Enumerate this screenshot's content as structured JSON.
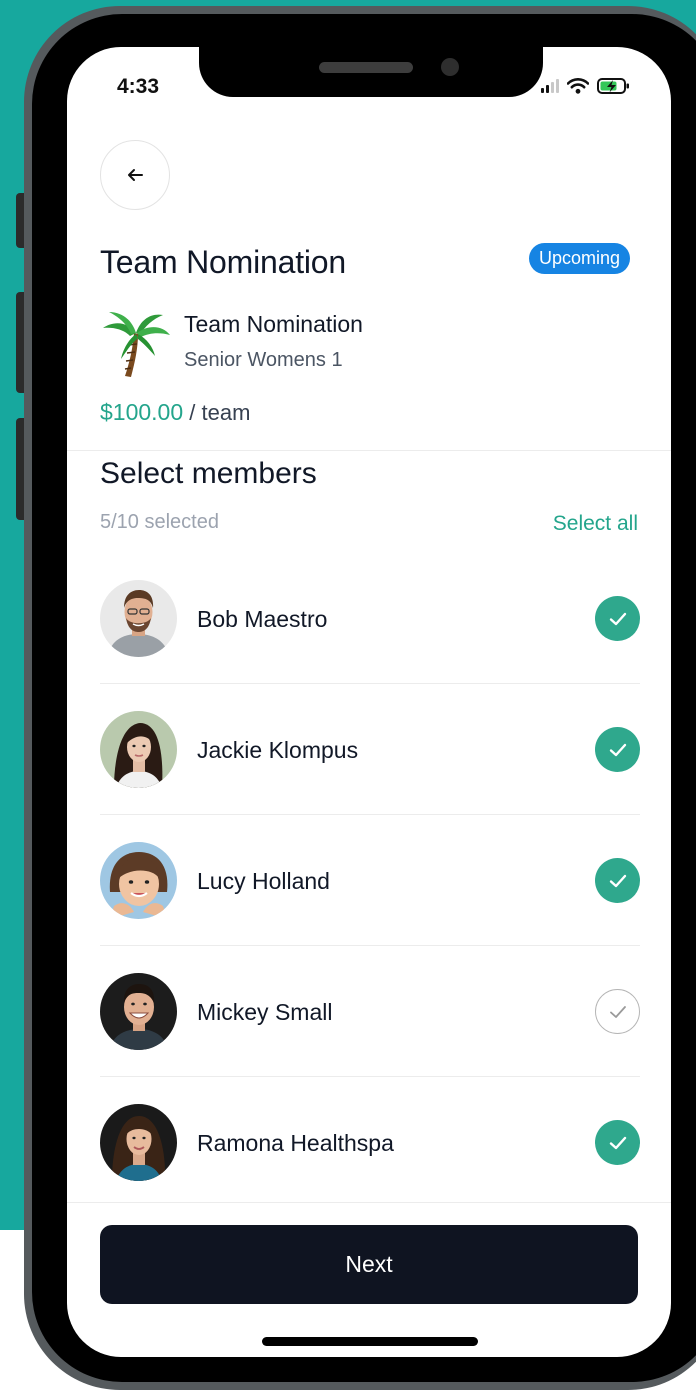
{
  "status_bar": {
    "time": "4:33"
  },
  "header": {
    "title": "Team Nomination",
    "badge": "Upcoming"
  },
  "event": {
    "icon": "palm-tree-icon",
    "name": "Team Nomination",
    "subtitle": "Senior Womens 1",
    "price": "$100.00",
    "price_unit": "/ team"
  },
  "members_section": {
    "title": "Select members",
    "selected_count": "5/10 selected",
    "select_all_label": "Select all",
    "members": [
      {
        "name": "Bob Maestro",
        "selected": true
      },
      {
        "name": "Jackie Klompus",
        "selected": true
      },
      {
        "name": "Lucy Holland",
        "selected": true
      },
      {
        "name": "Mickey Small",
        "selected": false
      },
      {
        "name": "Ramona Healthspa",
        "selected": true
      }
    ]
  },
  "footer": {
    "next_label": "Next"
  },
  "colors": {
    "background_teal": "#17a89e",
    "accent_green": "#24a58c",
    "badge_blue": "#1684e3",
    "primary_button": "#0f1421"
  }
}
